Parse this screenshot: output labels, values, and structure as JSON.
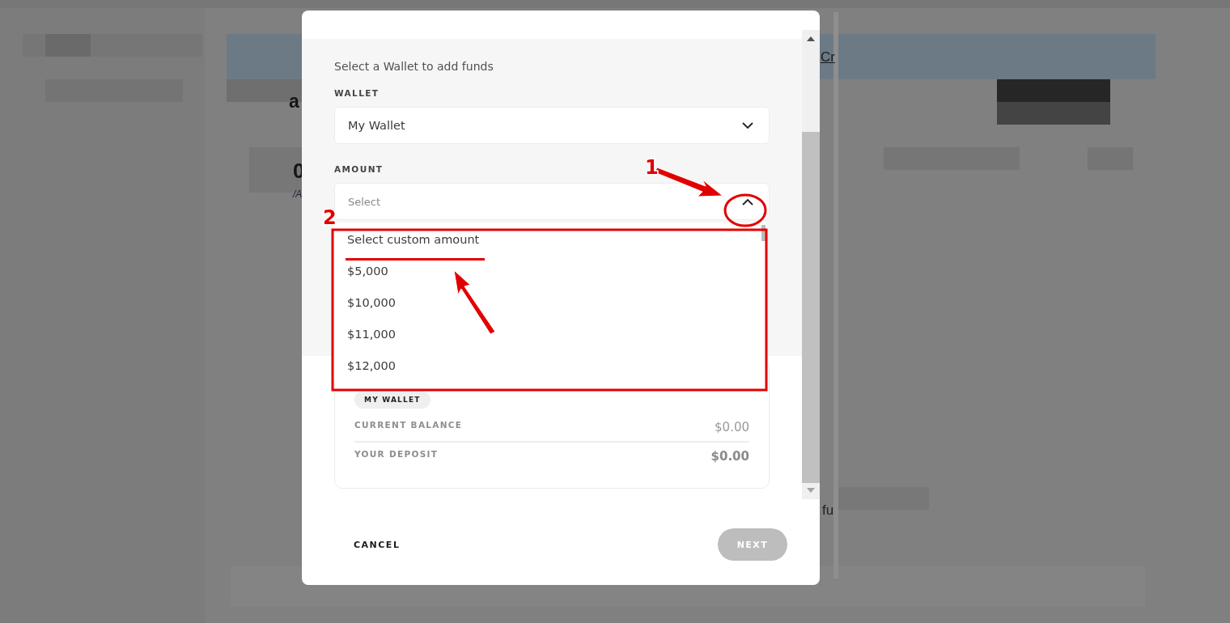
{
  "background": {
    "fragments": [
      {
        "text": "Cr",
        "kind": "link"
      },
      {
        "text": "a",
        "kind": "heading"
      },
      {
        "text": "0",
        "kind": "heading"
      },
      {
        "text": "/A",
        "kind": "small"
      },
      {
        "text": "fu",
        "kind": "body"
      }
    ]
  },
  "dialog": {
    "intro": "Select a Wallet to add funds",
    "fields": [
      {
        "label": "WALLET",
        "value": "My Wallet",
        "expanded": false
      },
      {
        "label": "AMOUNT",
        "placeholder": "Select",
        "expanded": true,
        "options": [
          "Select custom amount",
          "$5,000",
          "$10,000",
          "$11,000",
          "$12,000"
        ]
      }
    ],
    "summary": {
      "badge": "MY WALLET",
      "rows": [
        {
          "label": "CURRENT BALANCE",
          "value": "$0.00",
          "emphasis": false
        },
        {
          "label": "YOUR DEPOSIT",
          "value": "$0.00",
          "emphasis": true
        }
      ]
    },
    "buttons": [
      {
        "label": "CANCEL",
        "disabled": false
      },
      {
        "label": "NEXT",
        "disabled": true
      }
    ]
  },
  "annotations": [
    {
      "label": "1",
      "kind": "arrow"
    },
    {
      "label": "2",
      "kind": "frame"
    }
  ]
}
